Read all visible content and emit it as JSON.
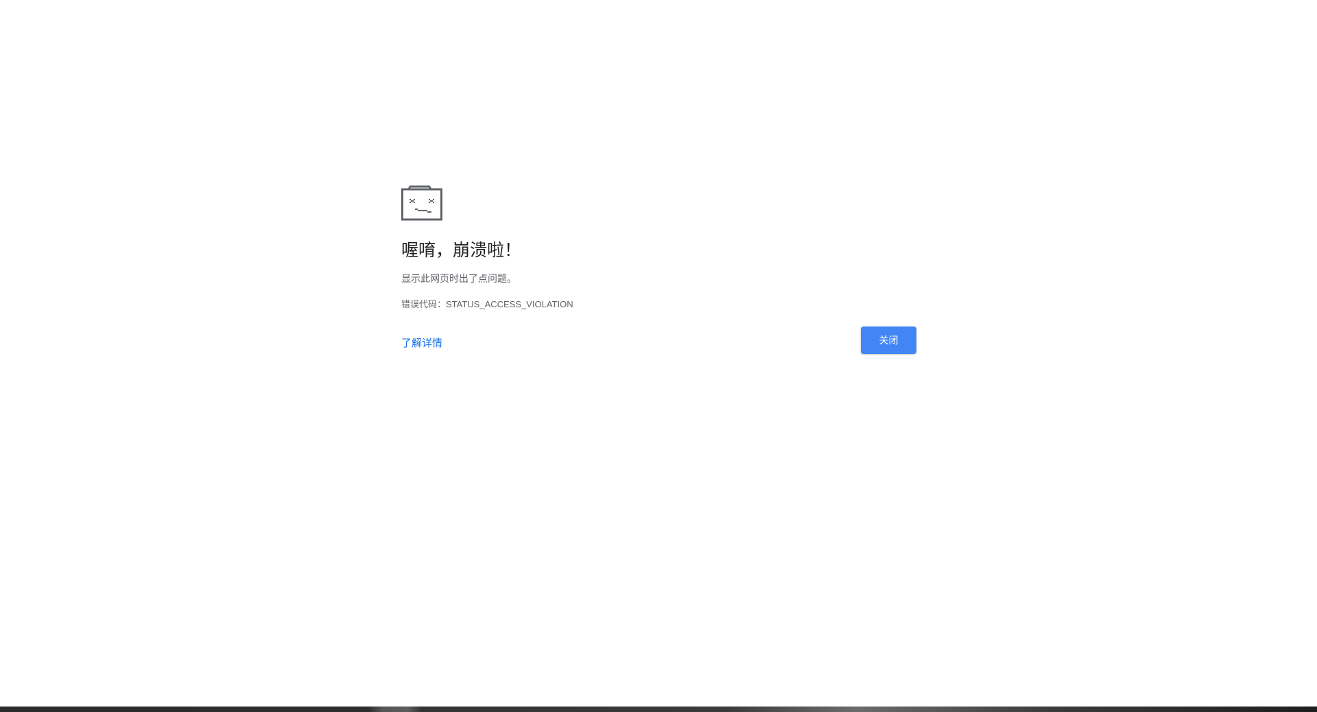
{
  "error_page": {
    "icon": "sad-folder-icon",
    "headline": "喔唷，崩溃啦！",
    "subtitle": "显示此网页时出了点问题。",
    "error_code": "错误代码：STATUS_ACCESS_VIOLATION",
    "learn_more_label": "了解详情",
    "close_label": "关闭"
  },
  "colors": {
    "background": "#ffffff",
    "headline_text": "#202124",
    "secondary_text": "#5f6368",
    "link": "#1a73e8",
    "button": "#4285f4",
    "icon": "#5f6368"
  }
}
